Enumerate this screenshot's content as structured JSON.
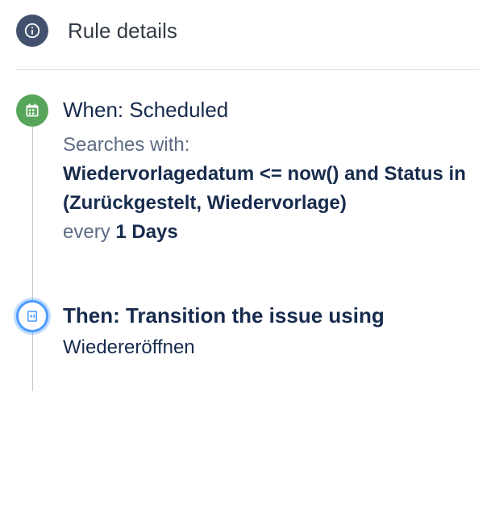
{
  "header": {
    "title": "Rule details"
  },
  "trigger": {
    "title": "When: Scheduled",
    "searches_label": "Searches with:",
    "jql": "Wiedervorlagedatum <= now() and Status in (Zurückgestelt, Wiedervorlage)",
    "every_label": "every",
    "interval": "1 Days"
  },
  "action": {
    "title": "Then: Transition the issue using",
    "transition": "Wiedereröffnen"
  }
}
